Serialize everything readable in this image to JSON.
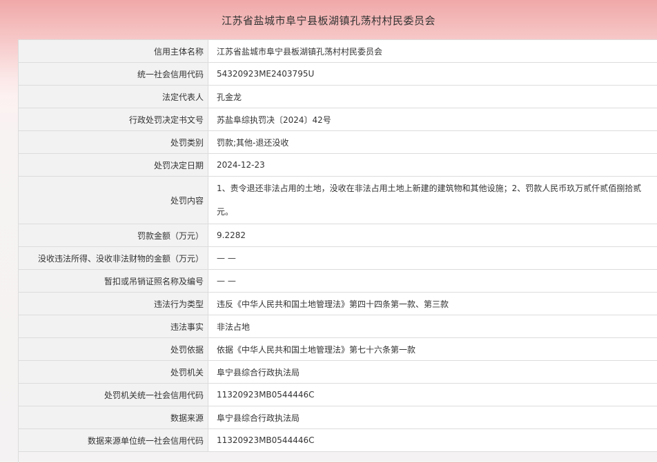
{
  "title": "江苏省盐城市阜宁县板湖镇孔荡村村民委员会",
  "rows": [
    {
      "label": "信用主体名称",
      "value": "江苏省盐城市阜宁县板湖镇孔荡村村民委员会"
    },
    {
      "label": "统一社会信用代码",
      "value": "54320923ME2403795U"
    },
    {
      "label": "法定代表人",
      "value": "孔金龙"
    },
    {
      "label": "行政处罚决定书文号",
      "value": "苏盐阜综执罚决〔2024〕42号"
    },
    {
      "label": "处罚类别",
      "value": "罚款;其他-退还没收"
    },
    {
      "label": "处罚决定日期",
      "value": "2024-12-23"
    },
    {
      "label": "处罚内容",
      "value": "1、责令退还非法占用的土地，没收在非法占用土地上新建的建筑物和其他设施；2、罚款人民币玖万贰仟贰佰捌拾贰元。"
    },
    {
      "label": "罚款金额（万元）",
      "value": "9.2282"
    },
    {
      "label": "没收违法所得、没收非法财物的金额（万元）",
      "value": "— —"
    },
    {
      "label": "暂扣或吊销证照名称及编号",
      "value": "— —"
    },
    {
      "label": "违法行为类型",
      "value": "违反《中华人民共和国土地管理法》第四十四条第一款、第三款"
    },
    {
      "label": "违法事实",
      "value": "非法占地"
    },
    {
      "label": "处罚依据",
      "value": "依据《中华人民共和国土地管理法》第七十六条第一款"
    },
    {
      "label": "处罚机关",
      "value": "阜宁县综合行政执法局"
    },
    {
      "label": "处罚机关统一社会信用代码",
      "value": "11320923MB0544446C"
    },
    {
      "label": "数据来源",
      "value": "阜宁县综合行政执法局"
    },
    {
      "label": "数据来源单位统一社会信用代码",
      "value": "11320923MB0544446C"
    }
  ]
}
